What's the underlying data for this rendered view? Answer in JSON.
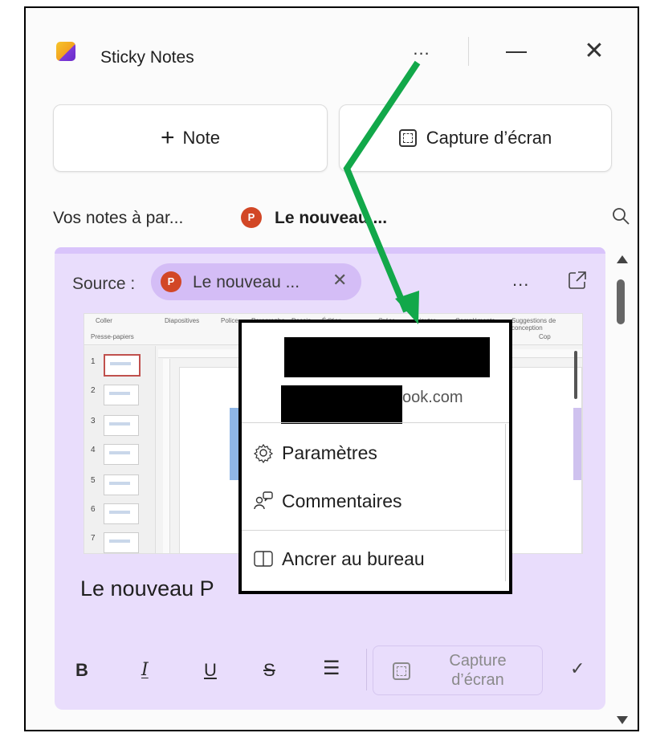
{
  "window": {
    "app_title": "Sticky Notes",
    "more_label": "...",
    "close_label": "✕"
  },
  "actions": {
    "new_note_plus": "+",
    "new_note_label": "Note",
    "capture_label": "Capture d’écran"
  },
  "filter": {
    "text": "Vos notes à par...",
    "app_badge": "P",
    "document": "Le nouveau ..."
  },
  "note": {
    "source_label": "Source :",
    "source_badge": "P",
    "source_chip": "Le nouveau ...",
    "chip_remove": "✕",
    "more_label": "...",
    "body_text": "Le nouveau P"
  },
  "screenshot_preview": {
    "ribbon_labels": [
      "Coller",
      "Presse-papiers",
      "Diapositives",
      "Police",
      "Paragraphe",
      "Dessin",
      "Édition",
      "Créer",
      "Ajouter",
      "Compléments",
      "Suggestions de conception",
      "Cop"
    ],
    "slide_numbers": [
      "1",
      "2",
      "3",
      "4",
      "5",
      "6",
      "7"
    ]
  },
  "format_bar": {
    "bold": "B",
    "italic": "I",
    "underline": "U",
    "strikethrough": "S",
    "list": "☰",
    "capture_line1": "Capture",
    "capture_line2": "d’écran",
    "confirm": "✓"
  },
  "menu": {
    "email_suffix": "ook.com",
    "items": [
      {
        "label": "Paramètres",
        "icon": "gear-icon"
      },
      {
        "label": "Commentaires",
        "icon": "feedback-icon"
      },
      {
        "label": "Ancrer au bureau",
        "icon": "dock-icon"
      }
    ]
  },
  "colors": {
    "note_bg": "#e9ddfc",
    "chip_bg": "#d4bdf6",
    "powerpoint": "#d24726",
    "annotation_arrow": "#12a84a"
  }
}
